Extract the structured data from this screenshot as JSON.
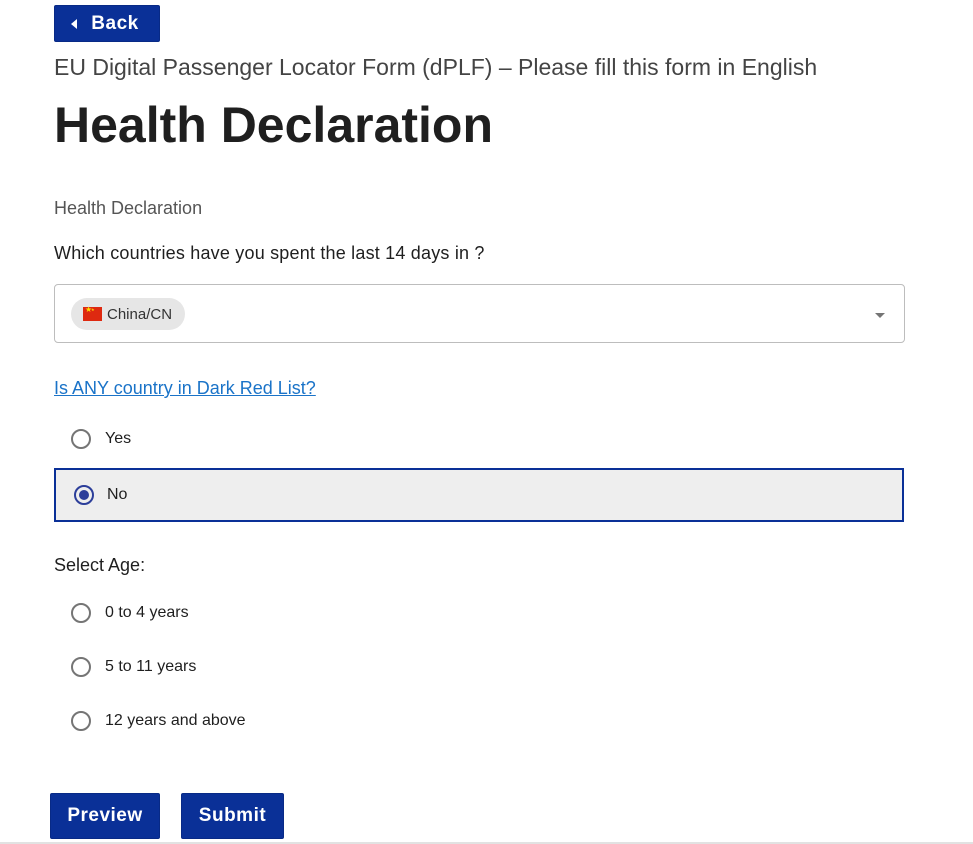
{
  "nav": {
    "back_label": "Back"
  },
  "header": {
    "subtitle": "EU Digital Passenger Locator Form (dPLF) – Please fill this form in English",
    "title": "Health Declaration"
  },
  "section": {
    "label": "Health Declaration"
  },
  "countries": {
    "question": "Which countries have you spent the last 14 days in ?",
    "selected": [
      {
        "label": "China/CN",
        "flag_icon": "flag-china-icon"
      }
    ]
  },
  "dark_red": {
    "link_text": "Is ANY country in Dark Red List?",
    "options": [
      {
        "label": "Yes",
        "selected": false
      },
      {
        "label": "No",
        "selected": true
      }
    ]
  },
  "age": {
    "label": "Select Age:",
    "options": [
      {
        "label": "0 to 4 years",
        "selected": false
      },
      {
        "label": "5 to 11 years",
        "selected": false
      },
      {
        "label": "12 years and above",
        "selected": false
      }
    ]
  },
  "actions": {
    "preview_label": "Preview",
    "submit_label": "Submit"
  },
  "colors": {
    "primary": "#0a3097",
    "link": "#1a73c8",
    "selected_bg": "#eeeeee",
    "flag_red": "#de2910",
    "flag_star": "#ffde00"
  }
}
